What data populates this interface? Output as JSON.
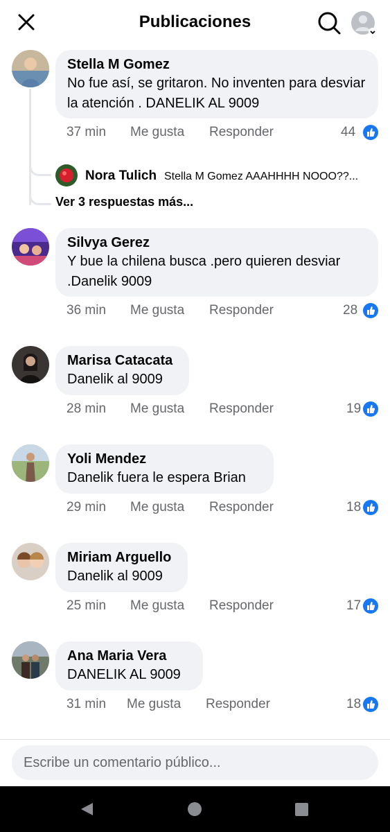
{
  "header": {
    "title": "Publicaciones"
  },
  "comments": [
    {
      "author": "Stella M Gomez",
      "text": "No fue así,  se gritaron. No inventen para desviar la atención  . DANELIK AL 9009",
      "time": "37 min",
      "like": "Me gusta",
      "reply": "Responder",
      "likes": "44",
      "replies": {
        "preview_author": "Nora Tulich",
        "preview_text": "Stella M Gomez AAAHHHH NOOO??...",
        "more": "Ver 3 respuestas más..."
      }
    },
    {
      "author": "Silvya Gerez",
      "text": "Y bue la chilena busca .pero quieren desviar .Danelik 9009",
      "time": "36 min",
      "like": "Me gusta",
      "reply": "Responder",
      "likes": "28"
    },
    {
      "author": "Marisa Catacata",
      "text": "Danelik al 9009",
      "time": "28 min",
      "like": "Me gusta",
      "reply": "Responder",
      "likes": "19"
    },
    {
      "author": "Yoli Mendez",
      "text": "Danelik fuera le espera Brian",
      "time": "29 min",
      "like": "Me gusta",
      "reply": "Responder",
      "likes": "18"
    },
    {
      "author": "Miriam Arguello",
      "text": "Danelik al 9009",
      "time": "25 min",
      "like": "Me gusta",
      "reply": "Responder",
      "likes": "17"
    },
    {
      "author": "Ana Maria Vera",
      "text": "DANELIK AL 9009",
      "time": "31 min",
      "like": "Me gusta",
      "reply": "Responder",
      "likes": "18"
    }
  ],
  "composer": {
    "placeholder": "Escribe un comentario público..."
  },
  "colors": {
    "accent": "#1877f2",
    "bubble": "#f0f2f5",
    "secondary_text": "#65676b"
  }
}
